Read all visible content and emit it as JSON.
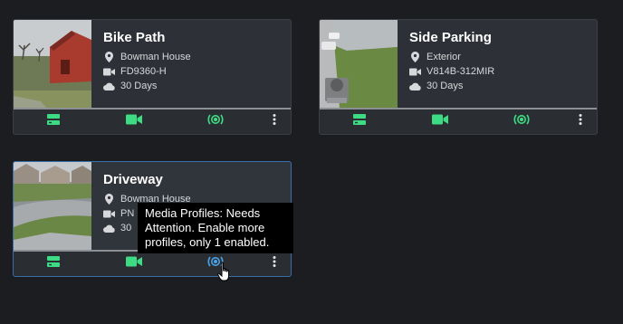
{
  "colors": {
    "accent_green": "#3ddc84",
    "card_bg": "#2d3036",
    "page_bg": "#1b1d21"
  },
  "cameras": [
    {
      "name": "Bike Path",
      "location": "Bowman House",
      "model": "FD9360-H",
      "retention": "30 Days"
    },
    {
      "name": "Side Parking",
      "location": "Exterior",
      "model": "V814B-312MIR",
      "retention": "30 Days"
    },
    {
      "name": "Driveway",
      "location": "Bowman House",
      "model": "PN",
      "retention": "30"
    }
  ],
  "icons": {
    "location": "map-pin-icon",
    "model": "video-camera-icon",
    "retention": "cloud-icon",
    "storage": "storage-icon",
    "live": "video-icon",
    "media_profiles": "broadcast-icon",
    "more": "kebab-menu-icon"
  },
  "tooltip": {
    "text": "Media Profiles: Needs Attention. Enable more profiles, only 1 enabled."
  }
}
